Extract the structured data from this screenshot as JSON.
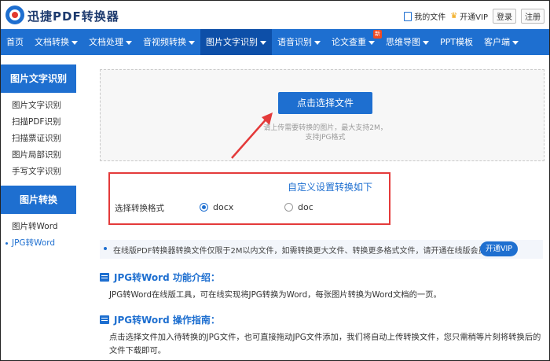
{
  "header": {
    "brand": "迅捷PDF转换器",
    "my_files": "我的文件",
    "open_vip": "开通VIP",
    "login": "登录",
    "register": "注册"
  },
  "nav": {
    "items": [
      {
        "label": "首页",
        "caret": false
      },
      {
        "label": "文档转换",
        "caret": true
      },
      {
        "label": "文档处理",
        "caret": true
      },
      {
        "label": "音视频转换",
        "caret": true
      },
      {
        "label": "图片文字识别",
        "caret": true,
        "active": true
      },
      {
        "label": "语音识别",
        "caret": true
      },
      {
        "label": "论文查重",
        "caret": true,
        "badge": "新"
      },
      {
        "label": "思维导图",
        "caret": true
      },
      {
        "label": "PPT模板",
        "caret": false
      },
      {
        "label": "客户端",
        "caret": true
      }
    ]
  },
  "sidebar": {
    "group1_title": "图片文字识别",
    "group1_items": [
      "图片文字识别",
      "扫描PDF识别",
      "扫描票证识别",
      "图片局部识别",
      "手写文字识别"
    ],
    "group2_title": "图片转换",
    "group2_items": [
      "图片转Word",
      "JPG转Word"
    ]
  },
  "upload": {
    "button": "点击选择文件",
    "tip_line1": "请上传需要转换的图片，最大支持2M，",
    "tip_line2": "支持JPG格式"
  },
  "settings": {
    "title": "自定义设置转换如下",
    "format_label": "选择转换格式",
    "options": [
      "docx",
      "doc"
    ],
    "selected": "docx"
  },
  "notice": {
    "text": "在线版PDF转换器转换文件仅限于2M以内文件，如需转换更大文件、转换更多格式文件，请开通在线版会员。",
    "button": "开通VIP"
  },
  "intro": {
    "title": "JPG转Word 功能介绍：",
    "body": "JPG转Word在线版工具，可在线实现将JPG转换为Word，每张图片转换为Word文档的一页。"
  },
  "guide": {
    "title": "JPG转Word 操作指南：",
    "body": "点击选择文件加入待转换的JPG文件，也可直接拖动JPG文件添加，我们将自动上传转换文件，您只需稍等片刻将转换后的文件下载即可。"
  },
  "colors": {
    "primary": "#1e6fd0",
    "nav_active": "#0d4fa8",
    "highlight_box": "#e43a3a"
  }
}
